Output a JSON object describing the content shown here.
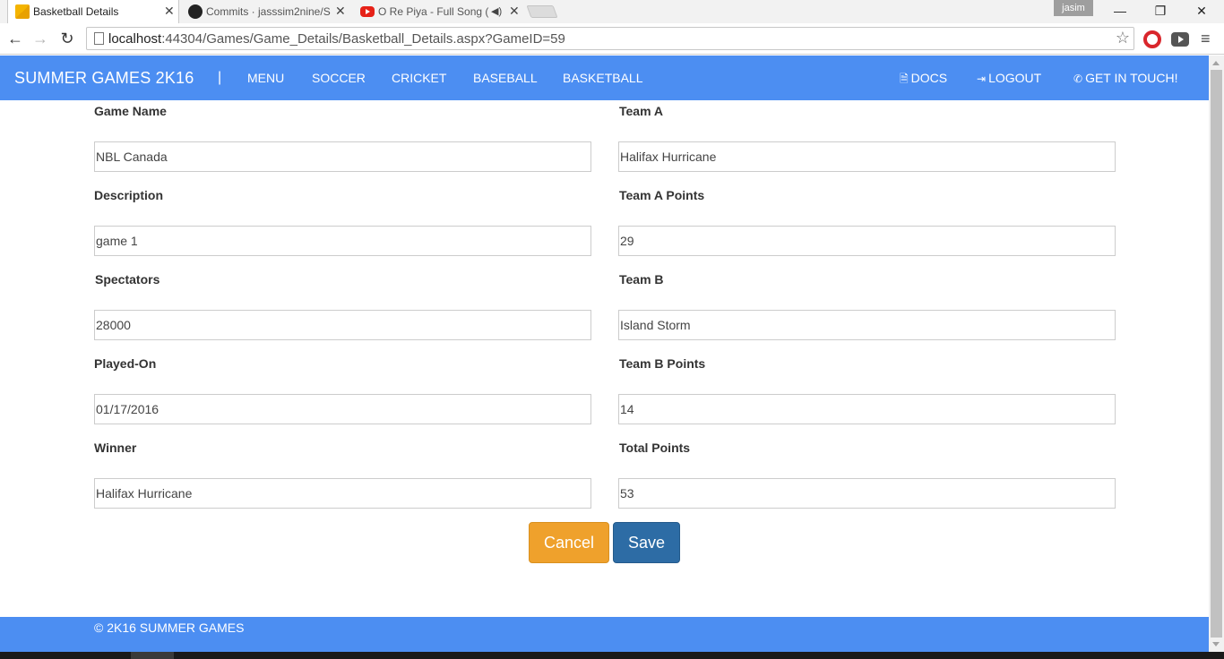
{
  "browser": {
    "tabs": [
      {
        "title": "Basketball Details",
        "icon": "page-favicon"
      },
      {
        "title": "Commits · jasssim2nine/S",
        "icon": "github-favicon"
      },
      {
        "title": "O Re Piya - Full Song (",
        "icon": "youtube-favicon"
      }
    ],
    "user_badge": "jasim",
    "url_host": "localhost",
    "url_rest": ":44304/Games/Game_Details/Basketball_Details.aspx?GameID=59"
  },
  "navbar": {
    "brand": "SUMMER GAMES 2K16",
    "separator": "|",
    "links": [
      "MENU",
      "SOCCER",
      "CRICKET",
      "BASEBALL",
      "BASKETBALL"
    ],
    "right_links": [
      {
        "label": "DOCS",
        "icon": "document-icon"
      },
      {
        "label": "LOGOUT",
        "icon": "logout-icon"
      },
      {
        "label": "GET IN TOUCH!",
        "icon": "phone-icon"
      }
    ]
  },
  "form": {
    "left": [
      {
        "label": "Game Name",
        "value": "NBL Canada"
      },
      {
        "label": "Description",
        "value": "game 1"
      },
      {
        "label": "Spectators",
        "value": "28000"
      },
      {
        "label": "Played-On",
        "value": "01/17/2016"
      },
      {
        "label": "Winner",
        "value": "Halifax Hurricane"
      }
    ],
    "right": [
      {
        "label": "Team A",
        "value": "Halifax Hurricane"
      },
      {
        "label": "Team A Points",
        "value": "29"
      },
      {
        "label": "Team B",
        "value": "Island Storm"
      },
      {
        "label": "Team B Points",
        "value": "14"
      },
      {
        "label": "Total Points",
        "value": "53"
      }
    ],
    "cancel_label": "Cancel",
    "save_label": "Save"
  },
  "footer": {
    "text": "© 2K16 SUMMER GAMES"
  },
  "colors": {
    "navbar": "#4c8ef2",
    "cancel": "#efa12c",
    "save": "#2d6ca5"
  }
}
